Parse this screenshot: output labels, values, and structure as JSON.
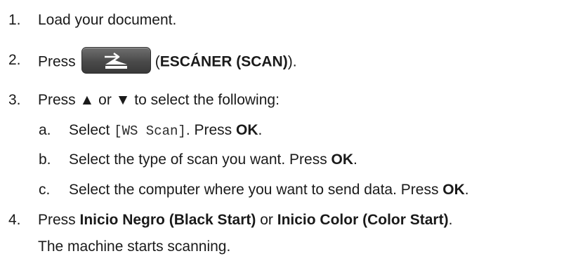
{
  "steps": [
    {
      "num": "1.",
      "text": "Load your document."
    },
    {
      "num": "2.",
      "prefix": "Press",
      "paren_open": "(",
      "bold": "ESCÁNER (SCAN)",
      "suffix": ").",
      "icon": "scan-icon"
    },
    {
      "num": "3.",
      "prefix": "Press ",
      "up": "▲",
      "mid": " or ",
      "down": "▼",
      "suffix": " to select the following:"
    },
    {
      "num": "4.",
      "prefix": "Press ",
      "bold1": "Inicio Negro (Black Start)",
      "mid": " or ",
      "bold2": "Inicio Color (Color Start)",
      "suffix": "."
    }
  ],
  "substeps": [
    {
      "letter": "a.",
      "prefix": "Select ",
      "code": "[WS Scan]",
      "mid": ". Press ",
      "bold": "OK",
      "suffix": "."
    },
    {
      "letter": "b.",
      "prefix": "Select the type of scan you want. Press ",
      "bold": "OK",
      "suffix": "."
    },
    {
      "letter": "c.",
      "prefix": "Select the computer where you want to send data. Press ",
      "bold": "OK",
      "suffix": "."
    }
  ],
  "result": "The machine starts scanning."
}
